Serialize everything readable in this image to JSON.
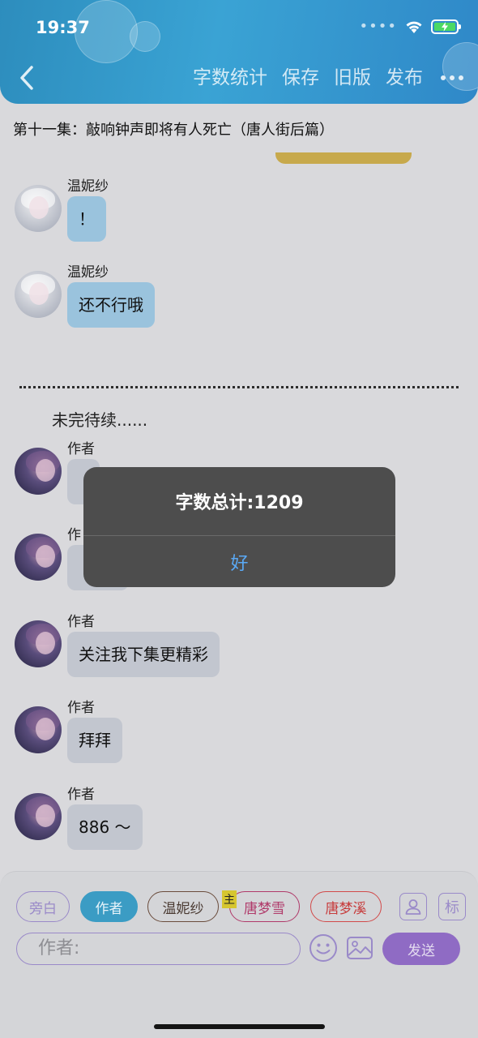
{
  "status_bar": {
    "time": "19:37"
  },
  "nav": {
    "actions": [
      {
        "label": "字数统计"
      },
      {
        "label": "保存"
      },
      {
        "label": "旧版"
      },
      {
        "label": "发布"
      }
    ],
    "more_icon": "more-dots-icon"
  },
  "episode": {
    "title": "第十一集：敲响钟声即将有人死亡（唐人街后篇）"
  },
  "messages": [
    {
      "sender": "温妮纱",
      "text": "！",
      "role": "wen"
    },
    {
      "sender": "温妮纱",
      "text": "还不行哦",
      "role": "wen"
    },
    {
      "sender": "作者",
      "text": "",
      "role": "author"
    },
    {
      "sender": "作",
      "text": "",
      "role": "author"
    },
    {
      "sender": "作者",
      "text": "关注我下集更精彩",
      "role": "author"
    },
    {
      "sender": "作者",
      "text": "拜拜",
      "role": "author"
    },
    {
      "sender": "作者",
      "text": "886 ～",
      "role": "author"
    }
  ],
  "to_be_continued": "未完待续......",
  "dialog": {
    "message": "字数总计:1209",
    "ok_label": "好"
  },
  "roles": [
    {
      "label": "旁白"
    },
    {
      "label": "作者"
    },
    {
      "label": "温妮纱"
    },
    {
      "label": "唐梦雪"
    },
    {
      "label": "唐梦溪"
    }
  ],
  "main_badge": "主",
  "tag_button_label": "标",
  "input": {
    "placeholder": "作者:"
  },
  "send_label": "发送",
  "colors": {
    "header_blue": "#3aa3d4",
    "send_purple": "#8f6bc4",
    "accent_purple": "#9a8ac9",
    "dialog_bg": "#4d4d4d",
    "link_blue": "#5aa9f5"
  }
}
